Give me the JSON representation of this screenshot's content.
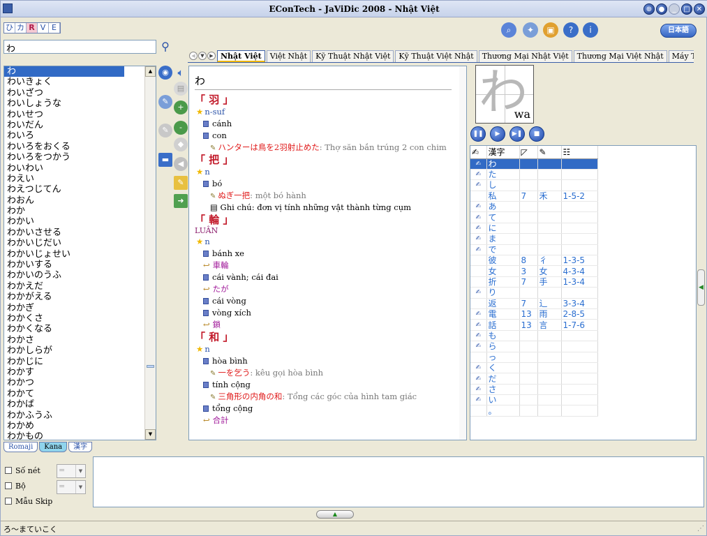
{
  "window": {
    "title": "EConTech - JaViDic 2008 - Nhật Việt"
  },
  "input_modes": [
    "ひ",
    "カ",
    "R",
    "V",
    "E"
  ],
  "toolbar_icons": [
    "search-book-icon",
    "tools-icon",
    "dictionary-icon",
    "help-icon",
    "info-icon"
  ],
  "language_button": "日本語",
  "search": {
    "value": "わ"
  },
  "word_list": [
    "わ",
    "わいきょく",
    "わいざつ",
    "わいしょうな",
    "わいせつ",
    "わいだん",
    "わいろ",
    "わいろをおくる",
    "わいろをつかう",
    "わいわい",
    "わえい",
    "わえつじてん",
    "わおん",
    "わか",
    "わかい",
    "わかいさせる",
    "わかいじだい",
    "わかいじょせい",
    "わかいする",
    "わかいのうふ",
    "わかえだ",
    "わかがえる",
    "わかぎ",
    "わかくさ",
    "わかくなる",
    "わかさ",
    "わかしらが",
    "わかじに",
    "わかす",
    "わかつ",
    "わかて",
    "わかば",
    "わかふうふ",
    "わかめ",
    "わかもの"
  ],
  "dict_tabs": [
    "Nhật Việt",
    "Việt Nhật",
    "Kỹ Thuật Nhật Việt",
    "Kỹ Thuật Việt Nhật",
    "Thương Mại Nhật Việt",
    "Thương Mại Việt Nhật",
    "Máy Tính Nhật Việt",
    "Máy T"
  ],
  "headword": "わ",
  "entries": [
    {
      "kanji": "「 羽 」",
      "reading": "",
      "pos": "n-suf",
      "meanings": [
        {
          "t": "cánh"
        },
        {
          "t": "con",
          "ex": [
            {
              "jp": "ハンターは鳥を2羽射止めた",
              "vi": ": Thợ săn bắn trúng 2 con chim"
            }
          ]
        }
      ],
      "note": "",
      "related": []
    },
    {
      "kanji": "「 把 」",
      "reading": "",
      "pos": "n",
      "meanings": [
        {
          "t": "bó",
          "ex": [
            {
              "jp": "ぬぎ一把",
              "vi": ": một bó hành"
            }
          ]
        }
      ],
      "note": "Ghi chú: đơn vị tính những vật thành từng cụm",
      "related": []
    },
    {
      "kanji": "「 輪 」",
      "reading": "LUÂN",
      "pos": "n",
      "meanings": [
        {
          "t": "bánh xe",
          "rel": "車輪"
        },
        {
          "t": "cái vành; cái đai",
          "rel": "たが"
        },
        {
          "t": "cái vòng"
        },
        {
          "t": "vòng xích",
          "rel": "鎖"
        }
      ],
      "note": "",
      "related": []
    },
    {
      "kanji": "「 和 」",
      "reading": "",
      "pos": "n",
      "meanings": [
        {
          "t": "hòa bình",
          "ex": [
            {
              "jp": "一を乞う",
              "vi": ": kêu gọi hòa bình"
            }
          ]
        },
        {
          "t": "tính cộng",
          "ex": [
            {
              "jp": "三角形の内角の和",
              "vi": ": Tổng các góc của hình tam giác"
            }
          ]
        },
        {
          "t": "tổng cộng",
          "rel": "合計"
        }
      ],
      "note": "",
      "related": []
    }
  ],
  "kanji_box": {
    "glyph": "わ",
    "romaji": "wa"
  },
  "kanji_table": {
    "headers": [
      "漢字",
      "",
      "",
      ""
    ],
    "rows": [
      {
        "icon": true,
        "k": "わ",
        "s": "",
        "r": "",
        "ref": "",
        "sel": true
      },
      {
        "icon": true,
        "k": "た",
        "s": "",
        "r": "",
        "ref": ""
      },
      {
        "icon": true,
        "k": "し",
        "s": "",
        "r": "",
        "ref": ""
      },
      {
        "icon": false,
        "k": "私",
        "s": "7",
        "r": "禾",
        "ref": "1-5-2"
      },
      {
        "icon": true,
        "k": "あ",
        "s": "",
        "r": "",
        "ref": ""
      },
      {
        "icon": true,
        "k": "て",
        "s": "",
        "r": "",
        "ref": ""
      },
      {
        "icon": true,
        "k": "に",
        "s": "",
        "r": "",
        "ref": ""
      },
      {
        "icon": true,
        "k": "ま",
        "s": "",
        "r": "",
        "ref": ""
      },
      {
        "icon": true,
        "k": "で",
        "s": "",
        "r": "",
        "ref": ""
      },
      {
        "icon": false,
        "k": "彼",
        "s": "8",
        "r": "彳",
        "ref": "1-3-5"
      },
      {
        "icon": false,
        "k": "女",
        "s": "3",
        "r": "女",
        "ref": "4-3-4"
      },
      {
        "icon": false,
        "k": "折",
        "s": "7",
        "r": "手",
        "ref": "1-3-4"
      },
      {
        "icon": true,
        "k": "り",
        "s": "",
        "r": "",
        "ref": ""
      },
      {
        "icon": false,
        "k": "返",
        "s": "7",
        "r": "辶",
        "ref": "3-3-4"
      },
      {
        "icon": true,
        "k": "電",
        "s": "13",
        "r": "雨",
        "ref": "2-8-5"
      },
      {
        "icon": true,
        "k": "話",
        "s": "13",
        "r": "言",
        "ref": "1-7-6"
      },
      {
        "icon": true,
        "k": "も",
        "s": "",
        "r": "",
        "ref": ""
      },
      {
        "icon": true,
        "k": "ら",
        "s": "",
        "r": "",
        "ref": ""
      },
      {
        "icon": false,
        "k": "っ",
        "s": "",
        "r": "",
        "ref": ""
      },
      {
        "icon": true,
        "k": "く",
        "s": "",
        "r": "",
        "ref": ""
      },
      {
        "icon": true,
        "k": "だ",
        "s": "",
        "r": "",
        "ref": ""
      },
      {
        "icon": true,
        "k": "さ",
        "s": "",
        "r": "",
        "ref": ""
      },
      {
        "icon": true,
        "k": "い",
        "s": "",
        "r": "",
        "ref": ""
      },
      {
        "icon": false,
        "k": "。",
        "s": "",
        "r": "",
        "ref": ""
      }
    ]
  },
  "mode_tabs": [
    "Romaji",
    "Kana",
    "漢字"
  ],
  "filters": {
    "stroke_label": "Số nét",
    "radical_label": "Bộ",
    "skip_label": "Mẫu Skip",
    "combo_placeholder": "="
  },
  "status": {
    "text": "ろ～まていこく"
  },
  "colors": {
    "accent": "#316ac5",
    "kanji_red": "#c21a2a",
    "kana_link": "#a01a9a"
  }
}
